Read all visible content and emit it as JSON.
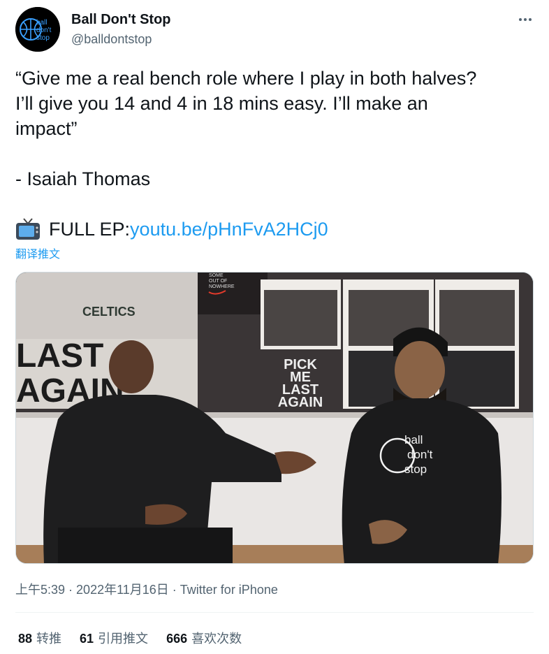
{
  "author": {
    "display_name": "Ball Don't Stop",
    "handle": "@balldontstop",
    "avatar_icon": "ball-dont-stop-logo",
    "avatar_text": [
      "ball",
      "don't",
      "stop"
    ]
  },
  "more_icon": "more-horizontal-icon",
  "tweet": {
    "lines": [
      "“Give me a real bench role where I play in both halves?",
      "I’ll give you 14 and 4 in 18 mins easy. I’ll make an",
      "impact”"
    ],
    "attribution": "- Isaiah Thomas",
    "full_ep_icon": "television-emoji-icon",
    "full_ep_label": "FULL EP: ",
    "link_text": "youtu.be/pHnFvA2HCj0"
  },
  "translate_label": "翻译推文",
  "media": {
    "description_icon": "video-thumbnail",
    "poster_text": [
      "PICK",
      "ME",
      "LAST",
      "AGAIN"
    ],
    "banner_text": [
      "LAST",
      "AGAIN"
    ],
    "jersey_text": "CELTICS",
    "nike_text": [
      "SOME",
      "OUT OF",
      "NOWHERE"
    ],
    "hoodie_text": [
      "ball",
      "don't",
      "stop"
    ]
  },
  "meta": {
    "time": "上午5:39",
    "separator": " · ",
    "date": "2022年11月16日",
    "source": "Twitter for iPhone"
  },
  "stats": [
    {
      "count": "88",
      "label": "转推"
    },
    {
      "count": "61",
      "label": "引用推文"
    },
    {
      "count": "666",
      "label": "喜欢次数"
    }
  ],
  "colors": {
    "link": "#1d9bf0",
    "secondary_text": "#536471",
    "primary_text": "#0f1419"
  }
}
